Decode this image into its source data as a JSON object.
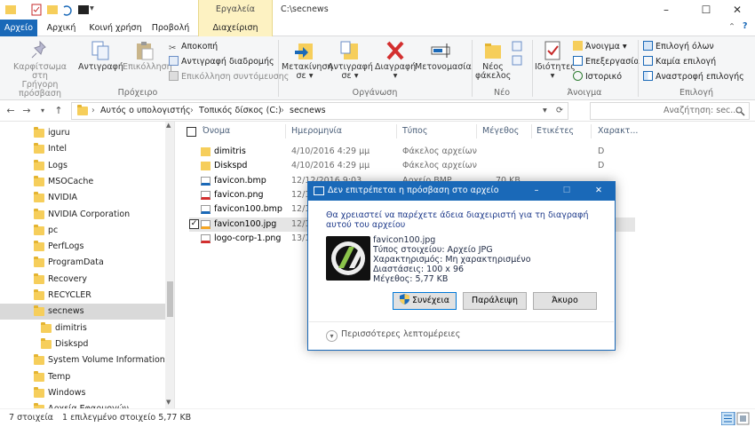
{
  "titlebar": {
    "context_group": "Εργαλεία εικόνας",
    "path": "C:\\secnews",
    "minimize": "–",
    "maximize": "☐",
    "close": "✕"
  },
  "tabs": {
    "file": "Αρχείο",
    "home": "Αρχική",
    "share": "Κοινή χρήση",
    "view": "Προβολή",
    "manage": "Διαχείριση"
  },
  "ribbon": {
    "clipboard": {
      "pin": [
        "Καρφίτσωμα στη",
        "Γρήγορη πρόσβαση"
      ],
      "copy": "Αντιγραφή",
      "paste": "Επικόλληση",
      "cut": "Αποκοπή",
      "copy_path": "Αντιγραφή διαδρομής",
      "paste_shortcut": "Επικόλληση συντόμευσης",
      "label": "Πρόχειρο"
    },
    "organize": {
      "move": [
        "Μετακίνηση",
        "σε ▾"
      ],
      "copyto": [
        "Αντιγραφή",
        "σε ▾"
      ],
      "delete": [
        "Διαγραφή",
        "▾"
      ],
      "rename": "Μετονομασία",
      "label": "Οργάνωση"
    },
    "new": {
      "folder": [
        "Νέος",
        "φάκελος"
      ],
      "label": "Νέο"
    },
    "open": {
      "properties": [
        "Ιδιότητες",
        "▾"
      ],
      "open": "Άνοιγμα ▾",
      "edit": "Επεξεργασία",
      "history": "Ιστορικό",
      "label": "Άνοιγμα"
    },
    "select": {
      "all": "Επιλογή όλων",
      "none": "Καμία επιλογή",
      "invert": "Αναστροφή επιλογής",
      "label": "Επιλογή"
    }
  },
  "address": {
    "crumbs": [
      "Αυτός ο υπολογιστής",
      "Τοπικός δίσκος (C:)",
      "secnews"
    ],
    "search_placeholder": "Αναζήτηση: sec...",
    "back": "←",
    "forward": "→",
    "up": "↑",
    "refresh": "⟳"
  },
  "navpane": {
    "items": [
      {
        "label": "iguru",
        "indent": 0
      },
      {
        "label": "Intel",
        "indent": 0
      },
      {
        "label": "Logs",
        "indent": 0
      },
      {
        "label": "MSOCache",
        "indent": 0
      },
      {
        "label": "NVIDIA",
        "indent": 0
      },
      {
        "label": "NVIDIA Corporation",
        "indent": 0
      },
      {
        "label": "pc",
        "indent": 0
      },
      {
        "label": "PerfLogs",
        "indent": 0
      },
      {
        "label": "ProgramData",
        "indent": 0
      },
      {
        "label": "Recovery",
        "indent": 0
      },
      {
        "label": "RECYCLER",
        "indent": 0
      },
      {
        "label": "secnews",
        "indent": 0,
        "selected": true
      },
      {
        "label": "dimitris",
        "indent": 1
      },
      {
        "label": "Diskspd",
        "indent": 1
      },
      {
        "label": "System Volume Information",
        "indent": 0
      },
      {
        "label": "Temp",
        "indent": 0
      },
      {
        "label": "Windows",
        "indent": 0
      },
      {
        "label": "Αρχεία Εφαρμογών",
        "indent": 0
      }
    ]
  },
  "filelist": {
    "headers": {
      "name": "Όνομα",
      "date": "Ημερομηνία",
      "type": "Τύπος",
      "size": "Μέγεθος",
      "tags": "Ετικέτες",
      "attrs": "Χαρακτ..."
    },
    "rows": [
      {
        "name": "dimitris",
        "date": "4/10/2016 4:29 μμ",
        "type": "Φάκελος αρχείων",
        "size": "",
        "attr": "D",
        "icon": "folder"
      },
      {
        "name": "Diskspd",
        "date": "4/10/2016 4:29 μμ",
        "type": "Φάκελος αρχείων",
        "size": "",
        "attr": "D",
        "icon": "folder"
      },
      {
        "name": "favicon.bmp",
        "date": "12/12/2016 9:03 ...",
        "type": "Αρχείο BMP",
        "size": "70 KB",
        "attr": "",
        "icon": "bmp"
      },
      {
        "name": "favicon.png",
        "date": "12/1...",
        "type": "",
        "size": "",
        "attr": "",
        "icon": "png"
      },
      {
        "name": "favicon100.bmp",
        "date": "12/1...",
        "type": "",
        "size": "",
        "attr": "",
        "icon": "bmp"
      },
      {
        "name": "favicon100.jpg",
        "date": "12/1...",
        "type": "",
        "size": "",
        "attr": "",
        "icon": "jpg",
        "selected": true,
        "checked": true
      },
      {
        "name": "logo-corp-1.png",
        "date": "13/1...",
        "type": "",
        "size": "",
        "attr": "",
        "icon": "png"
      }
    ]
  },
  "statusbar": {
    "count": "7 στοιχεία",
    "selected": "1 επιλεγμένο στοιχείο  5,77 KB"
  },
  "dialog": {
    "title": "Δεν επιτρέπεται η πρόσβαση στο αρχείο",
    "message": "Θα χρειαστεί να παρέχετε άδεια διαχειριστή για τη διαγραφή αυτού του αρχείου",
    "file_name": "favicon100.jpg",
    "file_type": "Τύπος στοιχείου: Αρχείο JPG",
    "rating": "Χαρακτηρισμός: Μη χαρακτηρισμένο",
    "dimensions": "Διαστάσεις: 100 x 96",
    "size": "Μέγεθος: 5,77 KB",
    "continue": "Συνέχεια",
    "skip": "Παράλειψη",
    "cancel": "Άκυρο",
    "more_details": "Περισσότερες λεπτομέρειες",
    "minimize": "–",
    "maximize": "☐",
    "close": "✕"
  },
  "colors": {
    "accent": "#1a69b8",
    "context_tab": "#fdf2c2",
    "folder": "#f6ce5b",
    "delete_red": "#d32f2f"
  }
}
